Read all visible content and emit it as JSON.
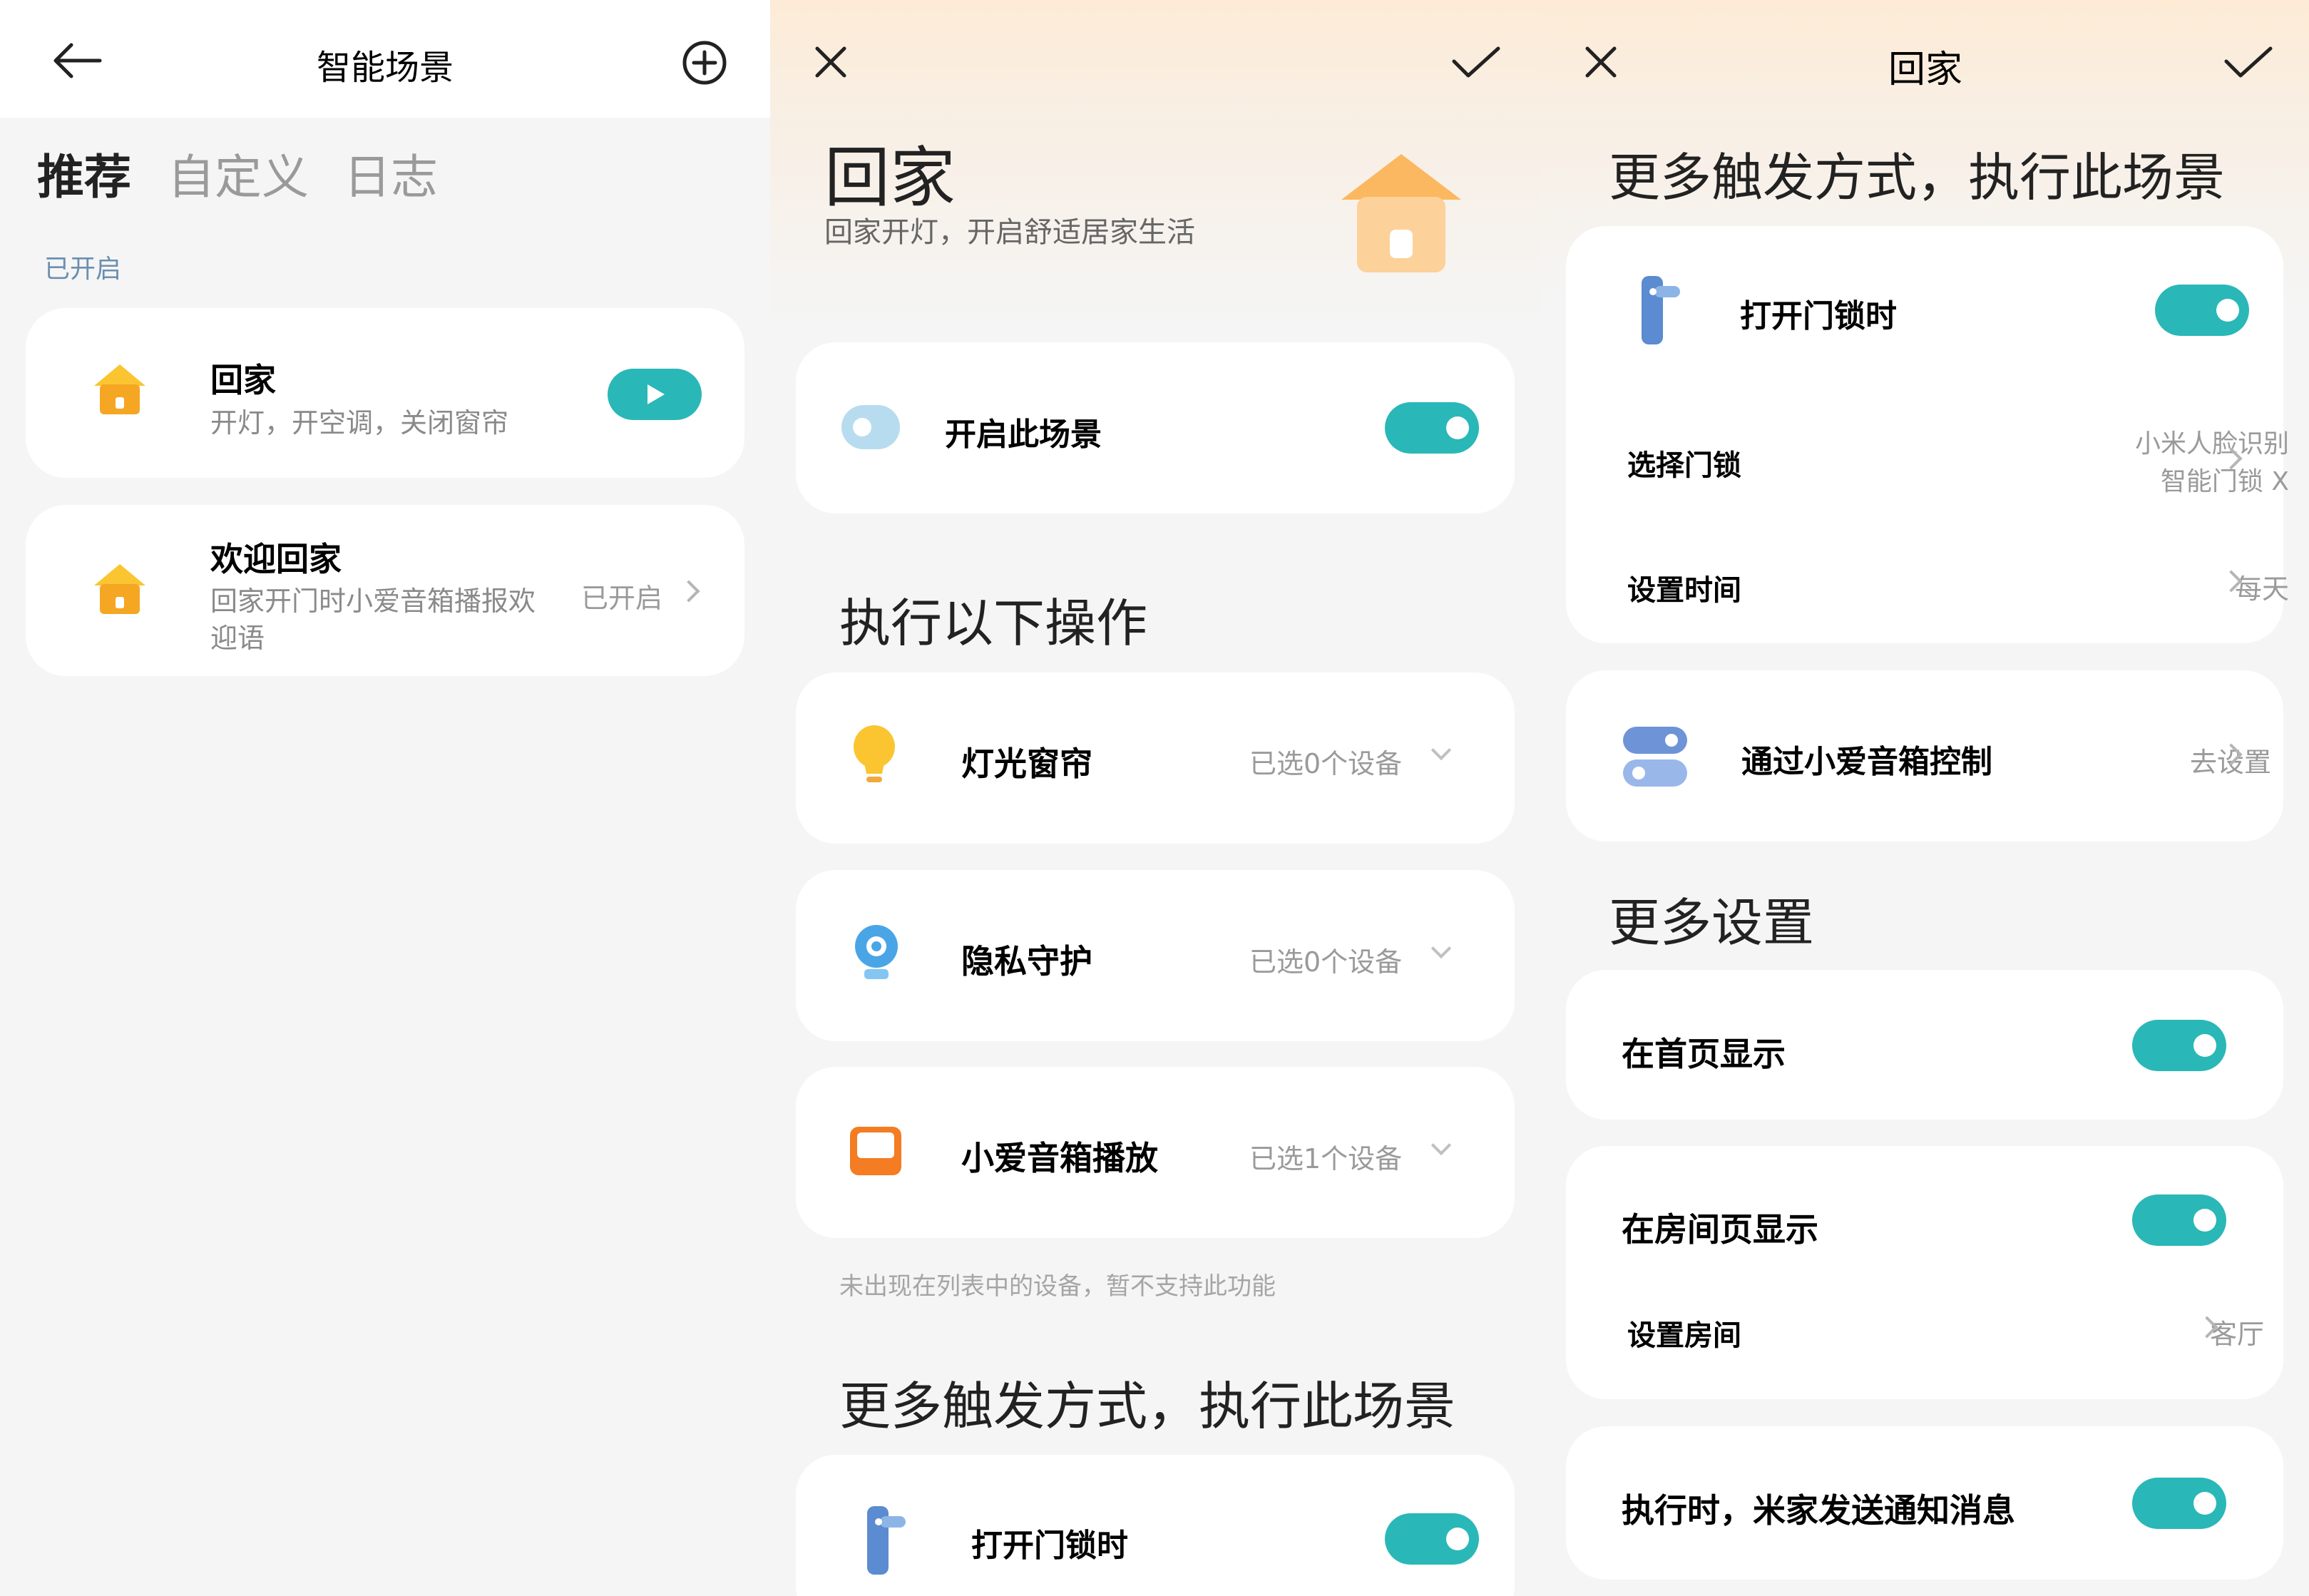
{
  "panel1": {
    "header_title": "智能场景",
    "tabs": [
      "推荐",
      "自定义",
      "日志"
    ],
    "section_label": "已开启",
    "scenes": [
      {
        "title": "回家",
        "desc": "开灯，开空调，关闭窗帘"
      },
      {
        "title": "欢迎回家",
        "desc_line1": "回家开门时小爱音箱播报欢",
        "desc_line2": "迎语",
        "status": "已开启"
      }
    ]
  },
  "panel2": {
    "title": "回家",
    "subtitle": "回家开灯，开启舒适居家生活",
    "enable_label": "开启此场景",
    "actions_heading": "执行以下操作",
    "actions": [
      {
        "label": "灯光窗帘",
        "value": "已选0个设备"
      },
      {
        "label": "隐私守护",
        "value": "已选0个设备"
      },
      {
        "label": "小爱音箱播放",
        "value": "已选1个设备"
      }
    ],
    "note": "未出现在列表中的设备，暂不支持此功能",
    "triggers_heading": "更多触发方式，执行此场景",
    "trigger_label": "打开门锁时"
  },
  "panel3": {
    "header_title": "回家",
    "triggers_heading": "更多触发方式，执行此场景",
    "lock_trigger_label": "打开门锁时",
    "select_lock_label": "选择门锁",
    "select_lock_value_line1": "小米人脸识别",
    "select_lock_value_line2": "智能门锁 X",
    "set_time_label": "设置时间",
    "set_time_value": "每天",
    "voice_label": "通过小爱音箱控制",
    "voice_value": "去设置",
    "more_settings_heading": "更多设置",
    "home_display_label": "在首页显示",
    "room_display_label": "在房间页显示",
    "set_room_label": "设置房间",
    "set_room_value": "客厅",
    "notify_label": "执行时，米家发送通知消息"
  },
  "colors": {
    "accent": "#2ab7b7",
    "house_yellow": "#fbc531",
    "house_orange": "#f5a623"
  }
}
